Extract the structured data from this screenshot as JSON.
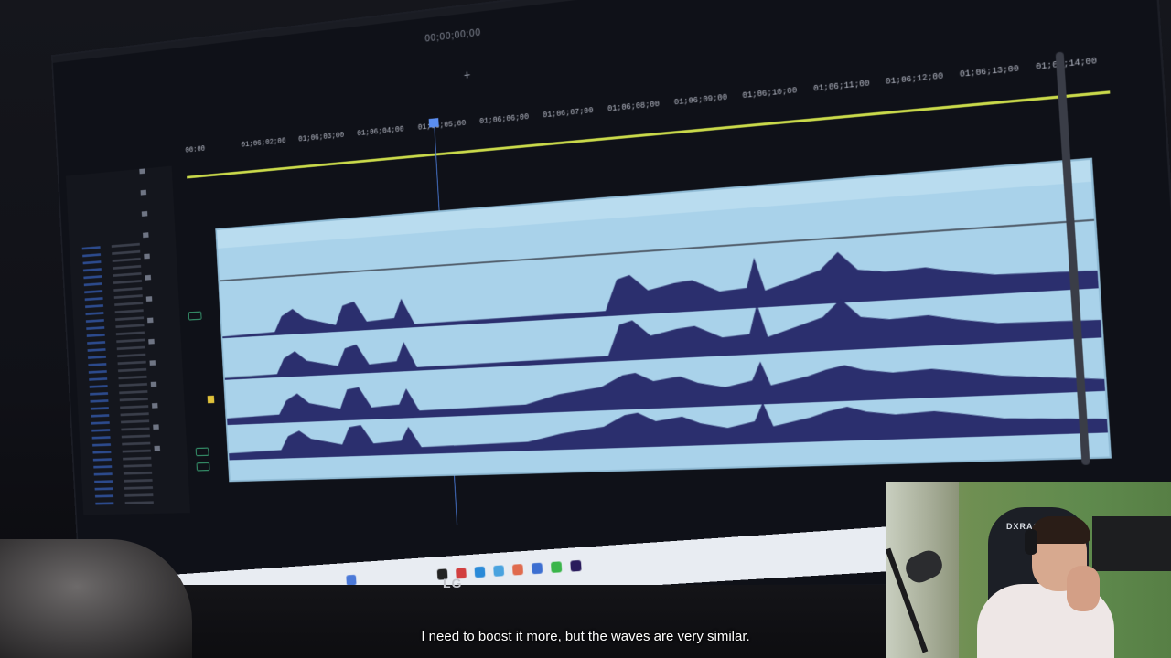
{
  "screen": {
    "timecode_top": "00;00;00;00",
    "ruler_ticks": [
      "00:00",
      "01;06;02;00",
      "01;06;03;00",
      "01;06;04;00",
      "01;06;05;00",
      "01;06;06;00",
      "01;06;07;00",
      "01;06;08;00",
      "01;06;09;00",
      "01;06;10;00",
      "01;06;11;00",
      "01;06;12;00",
      "01;06;13;00",
      "01;06;14;00"
    ],
    "monitor_brand": "LG",
    "accent_colors": {
      "ruler": "#c9d94a",
      "playhead": "#4a7bd8",
      "clip": "#a9d2ea",
      "waveform": "#2b2f6e"
    }
  },
  "webcam": {
    "chair_brand": "DXRACER"
  },
  "subtitle": "I need to boost it more, but the waves are very similar."
}
